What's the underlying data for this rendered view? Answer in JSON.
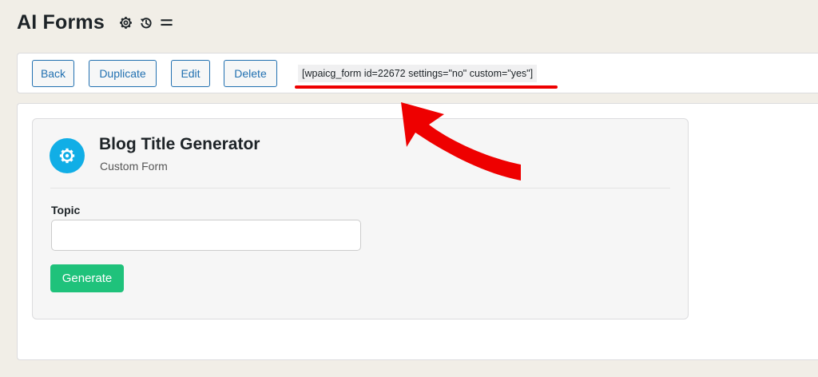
{
  "header": {
    "title": "AI Forms",
    "icons": [
      "gear-icon",
      "history-icon",
      "menu-icon"
    ]
  },
  "toolbar": {
    "back_label": "Back",
    "duplicate_label": "Duplicate",
    "edit_label": "Edit",
    "delete_label": "Delete",
    "shortcode": "[wpaicg_form id=22672 settings=\"no\" custom=\"yes\"]"
  },
  "form": {
    "title": "Blog Title Generator",
    "subtitle": "Custom Form",
    "icon": "gear-icon",
    "field_label": "Topic",
    "field_value": "",
    "generate_label": "Generate"
  },
  "colors": {
    "accent": "#2271b1",
    "form_icon_bg": "#11aee6",
    "generate_bg": "#1fc27b",
    "annotation": "#ee0000"
  }
}
